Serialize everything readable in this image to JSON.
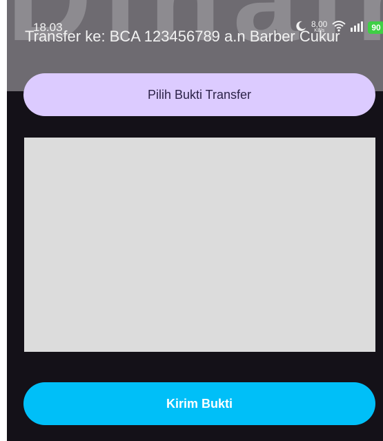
{
  "status_bar": {
    "time": "18.03",
    "net_speed_value": "8,00",
    "net_speed_unit": "KB/s",
    "battery": "90"
  },
  "watermark_text": "Dinain",
  "payment": {
    "transfer_info": "Transfer ke: BCA 123456789 a.n Barber Cukur"
  },
  "actions": {
    "select_proof_label": "Pilih Bukti Transfer",
    "send_proof_label": "Kirim Bukti"
  },
  "icons": [
    "moon-icon",
    "wifi-icon",
    "signal-icon",
    "charging-icon"
  ],
  "colors": {
    "select_button_bg": "#dccbff",
    "send_button_bg": "#00bff8",
    "preview_bg": "#dcdcdc",
    "background": "#141118"
  }
}
